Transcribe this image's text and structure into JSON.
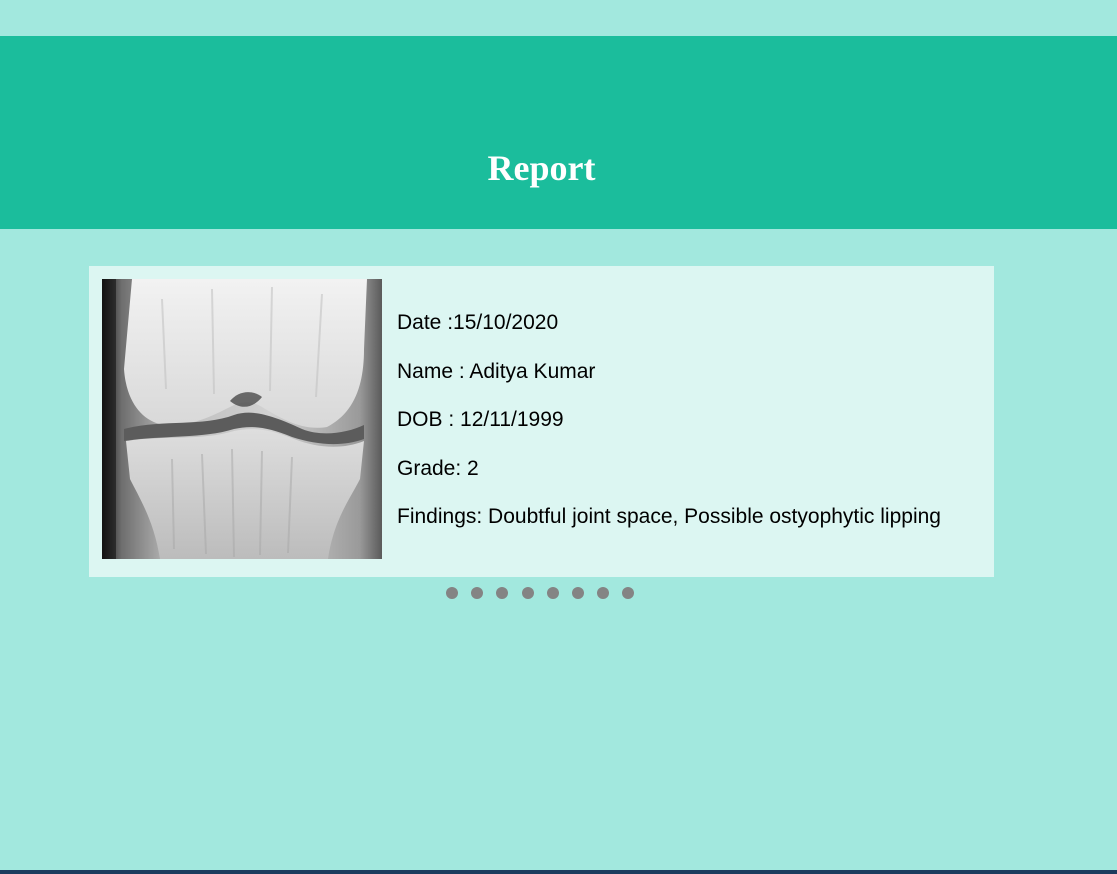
{
  "header": {
    "title": "Report"
  },
  "report": {
    "image_subject": "knee-xray-image",
    "date_line": "Date :15/10/2020",
    "name_line": "Name : Aditya Kumar",
    "dob_line": "DOB : 12/11/1999",
    "grade_line": "Grade: 2",
    "findings_line": "Findings: Doubtful joint space, Possible ostyophytic lipping"
  },
  "carousel": {
    "slide_count": 8
  },
  "colors": {
    "page_background": "#a2e8de",
    "header_background": "#1bbd9c",
    "card_background": "#dcf6f2",
    "dot_color": "#848484",
    "footer_line": "#1c3c5e"
  }
}
